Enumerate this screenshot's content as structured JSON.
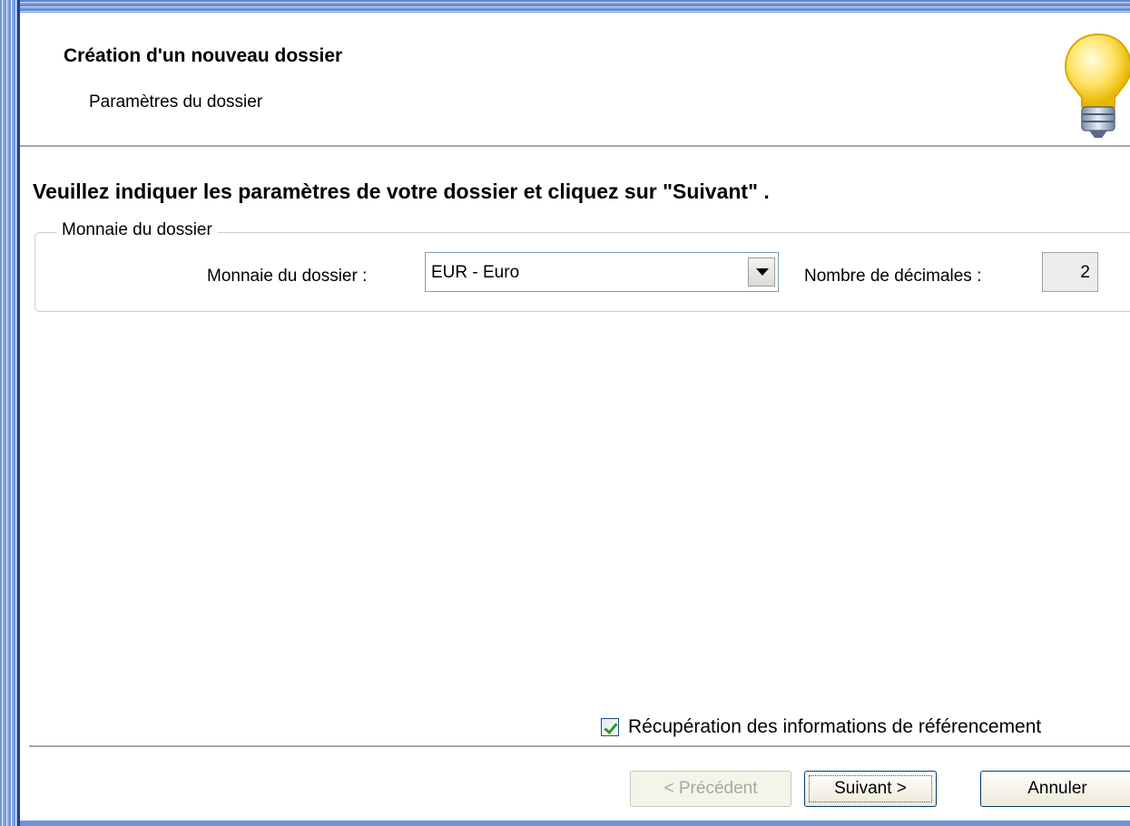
{
  "dialog": {
    "title": "Création d'un nouveau dossier",
    "subtitle": "Paramètres du dossier",
    "instruction": "Veuillez indiquer les paramètres de votre dossier et cliquez sur \"Suivant\" ."
  },
  "currency_group": {
    "legend": "Monnaie du dossier",
    "currency_label": "Monnaie du dossier :",
    "currency_value": "EUR - Euro",
    "decimals_label": "Nombre de décimales :",
    "decimals_value": "2"
  },
  "referencing": {
    "label": "Récupération des informations de référencement",
    "checked": true
  },
  "buttons": {
    "previous": "< Précédent",
    "next": "Suivant >",
    "cancel": "Annuler"
  },
  "icons": {
    "header_icon": "lightbulb-icon"
  }
}
